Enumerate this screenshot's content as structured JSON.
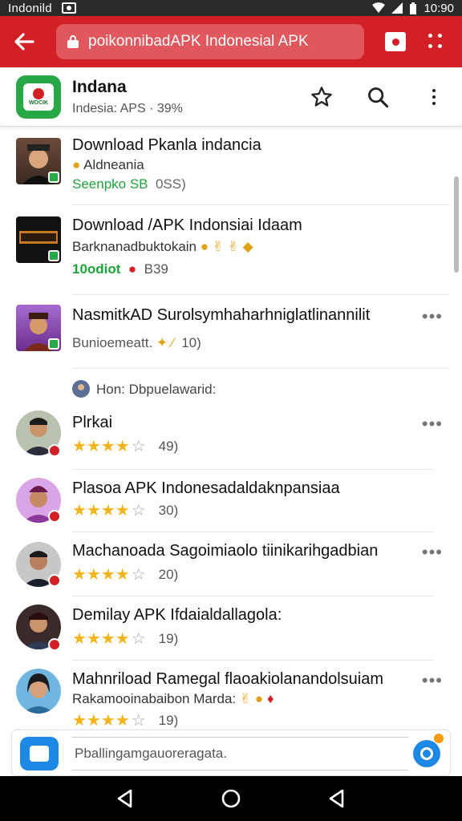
{
  "status_bar": {
    "carrier": "Indonild",
    "time": "10:90"
  },
  "browser": {
    "url": "poikonnibadAPK Indonesial APK"
  },
  "app": {
    "title": "Indana",
    "subtitle": "Indesia: APS · 39%"
  },
  "downloads": [
    {
      "title": "Download Pkanla indancia",
      "line2": "Aldneania",
      "line3_a": "Seenpko SB",
      "line3_b": "0SS)"
    },
    {
      "title": "Download /APK Indonsiai Idaam",
      "line2": "Barknanadbuktokain",
      "line3_a": "10odiot",
      "line3_b": "B39"
    },
    {
      "title": "NasmitkAD Surolsymhaharhniglatlinannilit",
      "line2": "Bunioemeatt.",
      "line3_b": "10)"
    }
  ],
  "reviews_header": {
    "label": "Hon: Dbpuelawarid:"
  },
  "reviews": [
    {
      "name": "Plrkai",
      "rating": 4,
      "count": "49)"
    },
    {
      "name": "Plasoa APK Indonesadaldaknpansiaa",
      "rating": 4,
      "count": "30)"
    },
    {
      "name": "Machanoada Sagoimiaolo tiinikarihgadbian",
      "rating": 4,
      "count": "20)"
    },
    {
      "name": "Demilay APK Ifdaialdallagola:",
      "rating": 4,
      "count": "19)"
    },
    {
      "name": "Mahnriload Ramegal flaoakiolanandolsuiam",
      "line2": "Rakamooinabaibon Marda:",
      "rating": 4,
      "count": "19)"
    }
  ],
  "reply": {
    "placeholder": "Pballingamgauoreragata."
  },
  "colors": {
    "brand_red": "#d32027",
    "green": "#27a844",
    "star": "#f3b31b"
  }
}
